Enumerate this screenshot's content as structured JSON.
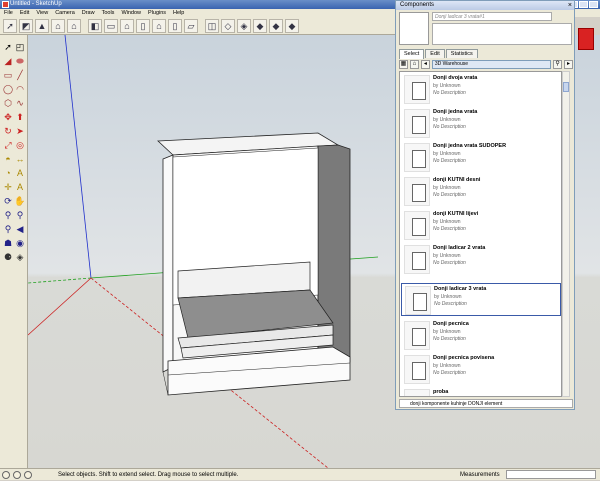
{
  "window": {
    "title": "Untitled - SketchUp"
  },
  "menu": [
    "File",
    "Edit",
    "View",
    "Camera",
    "Draw",
    "Tools",
    "Window",
    "Plugins",
    "Help"
  ],
  "toolbar": {
    "icons": [
      "select-icon",
      "eraser-icon",
      "paint-icon",
      "home-icon",
      "house-icon",
      "iso-icon",
      "top-view-icon",
      "front-view-icon",
      "right-view-icon",
      "back-view-icon",
      "left-view-icon",
      "bottom-view-icon",
      "xray-icon",
      "wireframe-icon",
      "hidden-line-icon",
      "shaded-icon",
      "textured-icon",
      "monochrome-icon"
    ]
  },
  "components": {
    "title": "Components",
    "preview_name": "Donji ladicar 3 vrata#1",
    "tabs": [
      "Select",
      "Edit",
      "Statistics"
    ],
    "active_tab": "Select",
    "search_value": "3D Warehouse",
    "items": [
      {
        "name": "Donji dvoja vrata",
        "by": "by Unknown",
        "desc": "No Description"
      },
      {
        "name": "Donji jedna vrata",
        "by": "by Unknown",
        "desc": "No Description"
      },
      {
        "name": "Donji jedna vrata SUDOPER",
        "by": "by Unknown",
        "desc": "No Description"
      },
      {
        "name": "donji KUTNI desni",
        "by": "by Unknown",
        "desc": "No Description"
      },
      {
        "name": "donji KUTNI lijevi",
        "by": "by Unknown",
        "desc": "No Description"
      },
      {
        "name": "Donji ladicar 2 vrata",
        "by": "by Unknown",
        "desc": "No Description"
      },
      {
        "name": "Donji ladicar 3 vrata",
        "by": "by Unknown",
        "desc": "No Description",
        "selected": true
      },
      {
        "name": "Donji pecnica",
        "by": "by Unknown",
        "desc": "No Description"
      },
      {
        "name": "Donji pecnica povisena",
        "by": "by Unknown",
        "desc": "No Description"
      },
      {
        "name": "proba",
        "by": "",
        "desc": ""
      }
    ],
    "footer": "donji komponente kuhinje DONJI element"
  },
  "status": {
    "message": "Select objects. Shift to extend select. Drag mouse to select multiple.",
    "measurements_label": "Measurements",
    "measurements_value": ""
  },
  "colors": {
    "axis_red": "#cc2020",
    "axis_green": "#20a020",
    "axis_blue": "#2030cc",
    "selection": "#3a5aa8"
  }
}
